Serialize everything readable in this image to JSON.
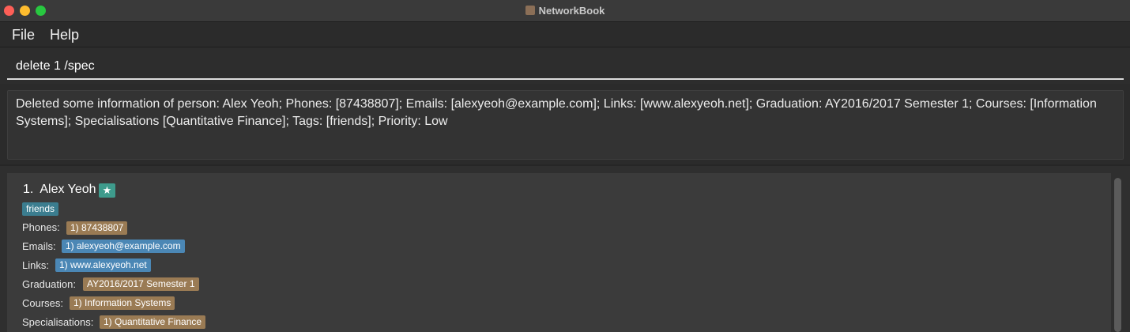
{
  "window": {
    "title": "NetworkBook",
    "icon": "app-icon"
  },
  "menu": {
    "file": "File",
    "help": "Help"
  },
  "command": {
    "value": "delete 1 /spec"
  },
  "result": {
    "message": "Deleted some information of person: Alex Yeoh; Phones: [87438807]; Emails: [alexyeoh@example.com]; Links: [www.alexyeoh.net]; Graduation: AY2016/2017 Semester 1; Courses: [Information Systems]; Specialisations [Quantitative Finance]; Tags: [friends]; Priority: Low"
  },
  "person": {
    "index": "1.",
    "name": "Alex Yeoh",
    "priority_icon": "star-icon",
    "tags": [
      "friends"
    ],
    "fields": {
      "phones": {
        "label": "Phones:",
        "values": [
          "1) 87438807"
        ]
      },
      "emails": {
        "label": "Emails:",
        "values": [
          "1) alexyeoh@example.com"
        ]
      },
      "links": {
        "label": "Links:",
        "values": [
          "1) www.alexyeoh.net"
        ]
      },
      "graduation": {
        "label": "Graduation:",
        "values": [
          "AY2016/2017 Semester 1"
        ]
      },
      "courses": {
        "label": "Courses:",
        "values": [
          "1) Information Systems"
        ]
      },
      "specialisations": {
        "label": "Specialisations:",
        "values": [
          "1) Quantitative Finance"
        ]
      }
    }
  },
  "colors": {
    "tag": "#3b7d8f",
    "chip_brown": "#9a7b54",
    "chip_blue": "#4b87b5",
    "priority_badge": "#3e9b8c"
  }
}
